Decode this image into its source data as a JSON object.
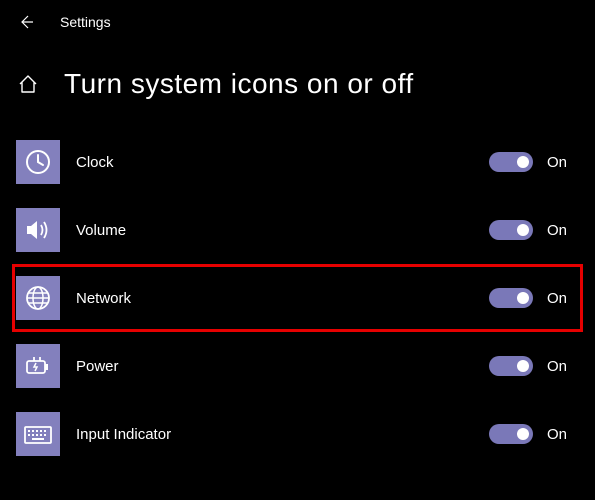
{
  "header": {
    "title": "Settings"
  },
  "page": {
    "title": "Turn system icons on or off"
  },
  "items": [
    {
      "label": "Clock",
      "state": "On",
      "icon": "clock-icon",
      "highlighted": false
    },
    {
      "label": "Volume",
      "state": "On",
      "icon": "volume-icon",
      "highlighted": false
    },
    {
      "label": "Network",
      "state": "On",
      "icon": "globe-icon",
      "highlighted": true
    },
    {
      "label": "Power",
      "state": "On",
      "icon": "power-icon",
      "highlighted": false
    },
    {
      "label": "Input Indicator",
      "state": "On",
      "icon": "keyboard-icon",
      "highlighted": false
    }
  ],
  "colors": {
    "accent": "#8380bd",
    "highlight": "#e60000"
  }
}
